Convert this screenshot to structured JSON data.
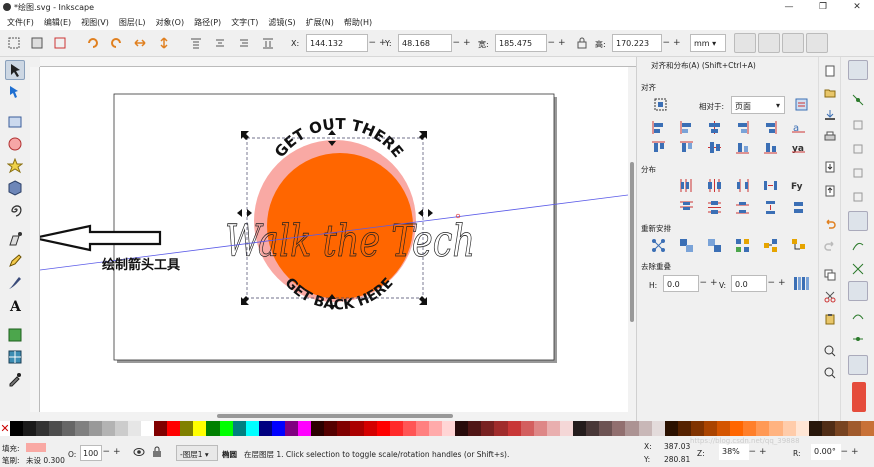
{
  "window": {
    "title": "*绘图.svg - Inkscape",
    "min": "—",
    "max": "❐",
    "close": "✕"
  },
  "menu": [
    "文件(F)",
    "编辑(E)",
    "视图(V)",
    "图层(L)",
    "对象(O)",
    "路径(P)",
    "文字(T)",
    "滤镜(S)",
    "扩展(N)",
    "帮助(H)"
  ],
  "toolbar": {
    "x_label": "X:",
    "x_value": "144.132",
    "y_label": "Y:",
    "y_value": "48.168",
    "w_label": "宽:",
    "w_value": "185.475",
    "h_label": "高:",
    "h_value": "170.223",
    "unit": "mm",
    "spin": "−+"
  },
  "canvas": {
    "top_arc_text": "GET OUT THERE",
    "bottom_arc_text": "GET BACK HERE",
    "script_text": "Walk the Tech",
    "annotation": "绘制箭头工具",
    "circle_outer_color": "#f9a9a4",
    "circle_inner_color": "#ff6600"
  },
  "dock": {
    "title": "对齐和分布(A) (Shift+Ctrl+A)",
    "align_section": "对齐",
    "relative_label": "相对于:",
    "relative_value": "页面",
    "distribute_section": "分布",
    "rearrange_section": "重新安排",
    "overlap_section": "去除重叠",
    "h_label": "H:",
    "h_value": "0.0",
    "v_label": "V:",
    "v_value": "0.0"
  },
  "palette": [
    "#000000",
    "#1a1a1a",
    "#333333",
    "#4d4d4d",
    "#666666",
    "#808080",
    "#999999",
    "#b3b3b3",
    "#cccccc",
    "#e6e6e6",
    "#ffffff",
    "#800000",
    "#ff0000",
    "#808000",
    "#ffff00",
    "#008000",
    "#00ff00",
    "#008080",
    "#00ffff",
    "#000080",
    "#0000ff",
    "#800080",
    "#ff00ff",
    "#2b0000",
    "#550000",
    "#800000",
    "#aa0000",
    "#d40000",
    "#ff0000",
    "#ff2a2a",
    "#ff5555",
    "#ff8080",
    "#ffaaaa",
    "#ffd5d5",
    "#280b0b",
    "#501616",
    "#782121",
    "#a02c2c",
    "#c83737",
    "#d35f5f",
    "#de8787",
    "#e9afaf",
    "#f4d7d7",
    "#241c1c",
    "#483737",
    "#6c5353",
    "#916f6f",
    "#ac9393",
    "#c8b7b7",
    "#e3dbdb",
    "#2b1100",
    "#552200",
    "#803300",
    "#aa4400",
    "#d45500",
    "#ff6600",
    "#ff7f2a",
    "#ff9955",
    "#ffb380",
    "#ffccaa",
    "#ffe6d5",
    "#28170b",
    "#502d16",
    "#784421",
    "#a05a2c",
    "#c87137"
  ],
  "status": {
    "fill_label": "填充:",
    "stroke_label": "笔刷:",
    "stroke_value": "未设 0.300",
    "fill_color": "#f9a9a4",
    "opacity_label": "O:",
    "opacity_value": "100",
    "layer_value": "-图层1 ▾",
    "message_bold": "椭圆",
    "message": "在层图层 1. Click selection to toggle scale/rotation handles (or Shift+s).",
    "x_label": "X:",
    "x_value": "387.03",
    "y_label": "Y:",
    "y_value": "280.81",
    "z_label": "Z:",
    "z_value": "38%",
    "r_label": "R:",
    "r_value": "0.00°",
    "watermark": "https://blog.csdn.net/qq_39888"
  }
}
